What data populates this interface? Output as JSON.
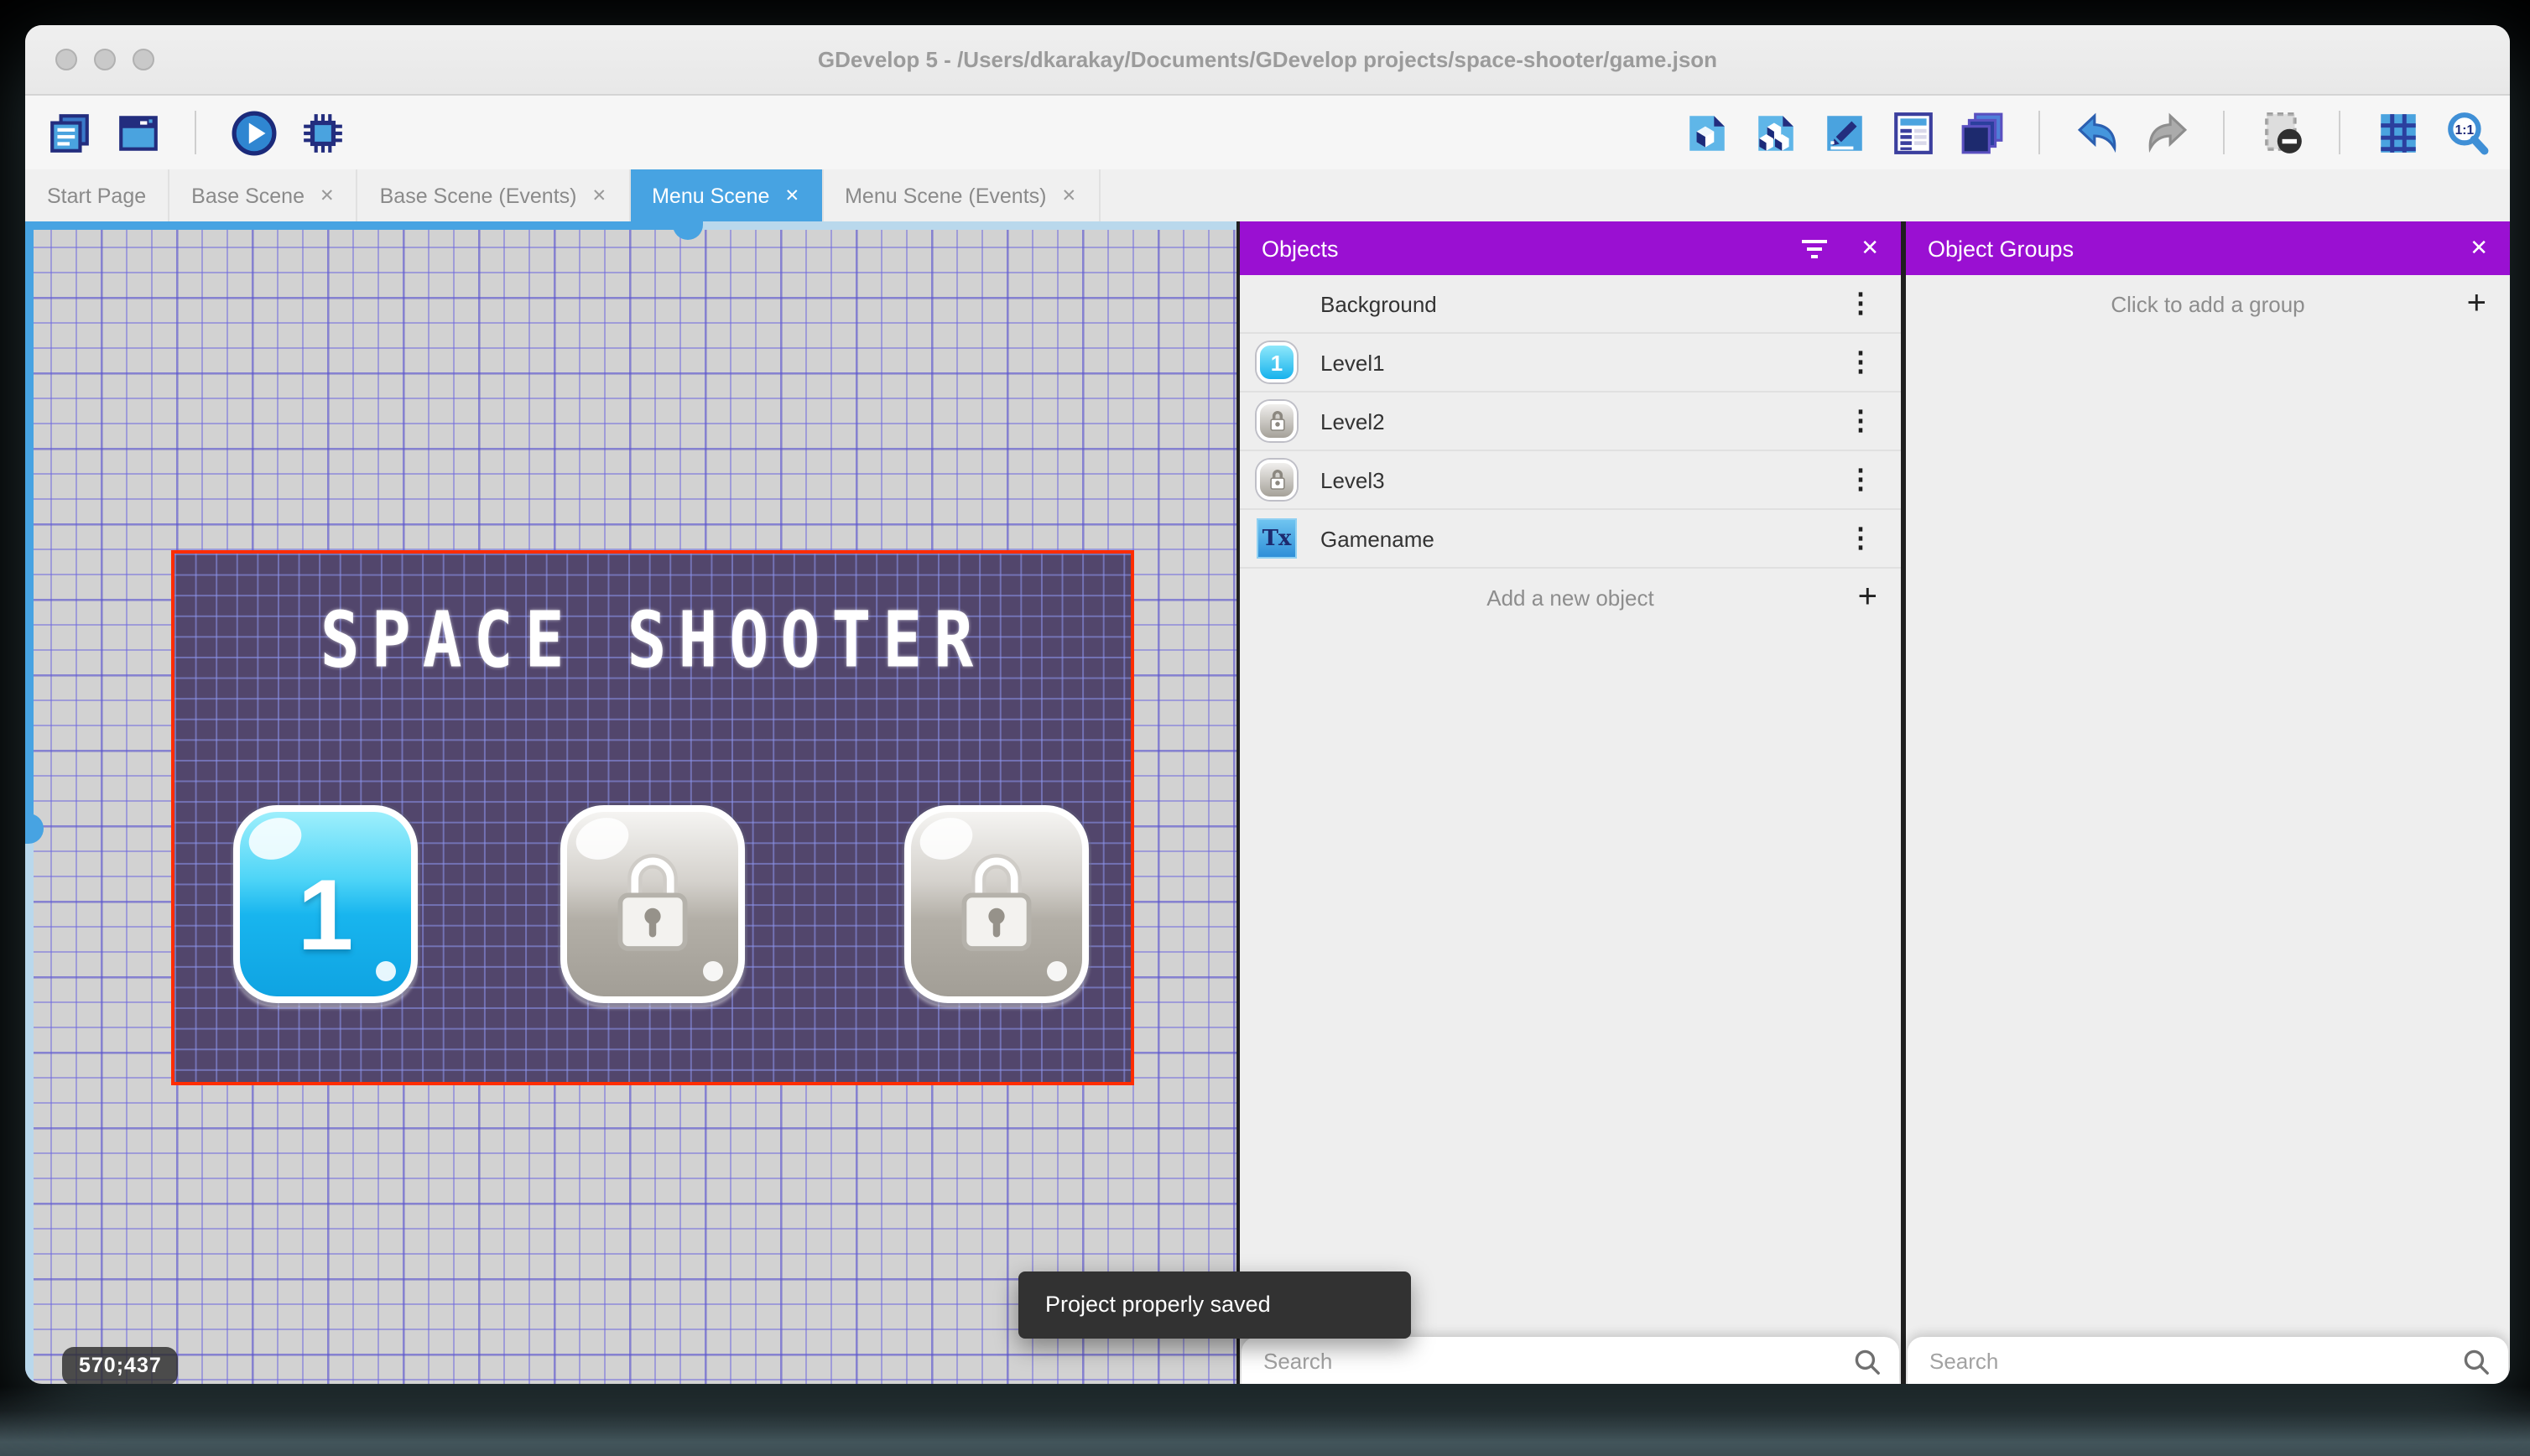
{
  "window": {
    "title": "GDevelop 5 - /Users/dkarakay/Documents/GDevelop projects/space-shooter/game.json"
  },
  "tabs": [
    {
      "label": "Start Page",
      "active": false,
      "closable": false
    },
    {
      "label": "Base Scene",
      "active": false,
      "closable": true
    },
    {
      "label": "Base Scene (Events)",
      "active": false,
      "closable": true
    },
    {
      "label": "Menu Scene",
      "active": true,
      "closable": true
    },
    {
      "label": "Menu Scene (Events)",
      "active": false,
      "closable": true
    }
  ],
  "toolbar": {
    "left_icons": [
      "project-manager",
      "scene-window",
      "preview-play",
      "debugger"
    ],
    "right_icons": [
      "objects-panel",
      "object-groups-panel",
      "properties",
      "instances-list",
      "layers",
      "undo",
      "redo",
      "window-mask",
      "grid",
      "zoom-1-1"
    ]
  },
  "objects_panel": {
    "title": "Objects",
    "items": [
      {
        "name": "Background",
        "thumb": "purple-square"
      },
      {
        "name": "Level1",
        "thumb": "blue-button-1"
      },
      {
        "name": "Level2",
        "thumb": "locked-button"
      },
      {
        "name": "Level3",
        "thumb": "locked-button"
      },
      {
        "name": "Gamename",
        "thumb": "text-object"
      }
    ],
    "add_label": "Add a new object",
    "search_placeholder": "Search"
  },
  "object_groups_panel": {
    "title": "Object Groups",
    "add_label": "Click to add a group",
    "search_placeholder": "Search"
  },
  "scene": {
    "title_text": "SPACE SHOOTER",
    "buttons": [
      {
        "type": "level",
        "label": "1",
        "state": "unlocked"
      },
      {
        "type": "level",
        "state": "locked"
      },
      {
        "type": "level",
        "state": "locked"
      }
    ]
  },
  "statusbar": {
    "coordinates": "570;437"
  },
  "toast": {
    "message": "Project properly saved"
  },
  "icons": {
    "close": "✕",
    "plus": "+",
    "menu_dots": "⋮",
    "zoom_label": "1:1",
    "text_object_glyph": "Tx"
  },
  "colors": {
    "accent_blue": "#47a3e2",
    "header_purple": "#9a10d2",
    "scene_background": "#52466c",
    "selection_red": "#ff2d00",
    "canvas_background": "#d2d2d2"
  }
}
